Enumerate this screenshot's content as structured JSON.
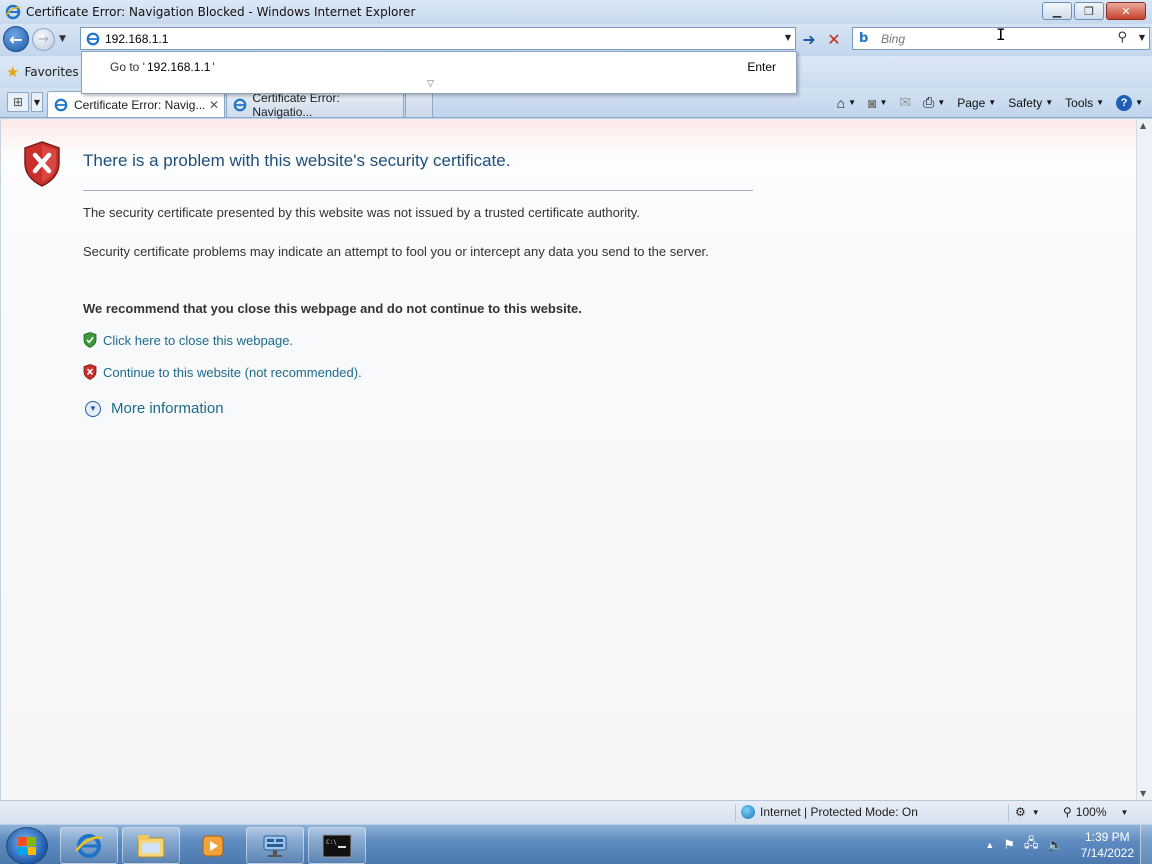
{
  "window": {
    "title": "Certificate Error: Navigation Blocked - Windows Internet Explorer"
  },
  "navbar": {
    "address_value": "192.168.1.1",
    "search_placeholder": "Bing"
  },
  "autocomplete": {
    "goto_prefix": "Go to '",
    "goto_url": "192.168.1.1",
    "goto_suffix": "'",
    "enter_label": "Enter"
  },
  "favorites": {
    "label": "Favorites"
  },
  "tabs": [
    {
      "title": "Certificate Error: Navig...",
      "active": true
    },
    {
      "title": "Certificate Error: Navigatio...",
      "active": false
    }
  ],
  "commandbar": {
    "page_label": "Page",
    "safety_label": "Safety",
    "tools_label": "Tools"
  },
  "content": {
    "heading": "There is a problem with this website's security certificate.",
    "paragraph1": "The security certificate presented by this website was not issued by a trusted certificate authority.",
    "paragraph2": "Security certificate problems may indicate an attempt to fool you or intercept any data you send to the server.",
    "recommendation": "We recommend that you close this webpage and do not continue to this website.",
    "close_link": "Click here to close this webpage.",
    "continue_link": "Continue to this website (not recommended).",
    "more_info": "More information"
  },
  "statusbar": {
    "zone": "Internet | Protected Mode: On",
    "zoom": "100%"
  },
  "taskbar": {
    "time": "1:39 PM",
    "date": "7/14/2022"
  },
  "colors": {
    "heading": "#1f4e79",
    "link": "#1e6a8a",
    "shield_red": "#c9302c",
    "shield_green": "#3c9a3c"
  }
}
